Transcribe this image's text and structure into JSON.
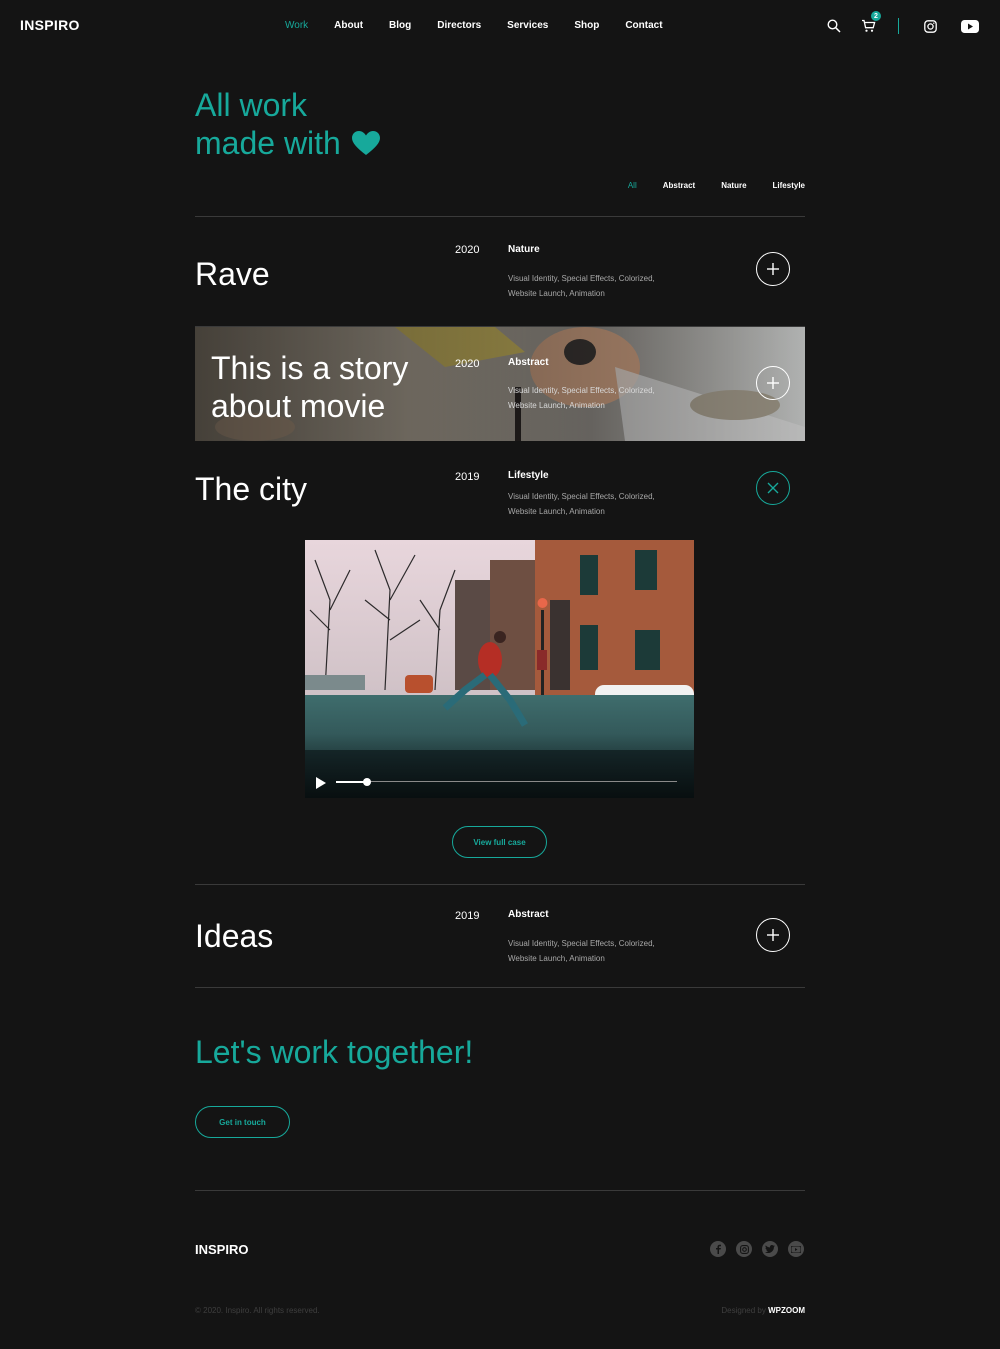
{
  "header": {
    "logo": "INSPIRO",
    "nav": [
      "Work",
      "About",
      "Blog",
      "Directors",
      "Services",
      "Shop",
      "Contact"
    ],
    "active_nav": "Work",
    "cart_count": "2",
    "icons": [
      "search-icon",
      "cart-icon",
      "instagram-icon",
      "youtube-icon"
    ]
  },
  "hero": {
    "line1": "All work",
    "line2": "made with",
    "icon": "heart-icon"
  },
  "filters": [
    "All",
    "Abstract",
    "Nature",
    "Lifestyle"
  ],
  "projects": [
    {
      "title": "Rave",
      "year": "2020",
      "category": "Nature",
      "tags_line1": "Visual Identity, Special Effects, Colorized,",
      "tags_line2": "Website Launch, Animation",
      "action": "plus-icon"
    },
    {
      "title_line1": "This is a story",
      "title_line2": "about movie",
      "year": "2020",
      "category": "Abstract",
      "tags_line1": "Visual Identity, Special Effects, Colorized,",
      "tags_line2": "Website Launch, Animation",
      "action": "plus-icon"
    },
    {
      "title": "The city",
      "year": "2019",
      "category": "Lifestyle",
      "tags_line1": "Visual Identity, Special Effects, Colorized,",
      "tags_line2": "Website Launch, Animation",
      "action": "close-icon"
    },
    {
      "title": "Ideas",
      "year": "2019",
      "category": "Abstract",
      "tags_line1": "Visual Identity, Special Effects, Colorized,",
      "tags_line2": "Website Launch, Animation",
      "action": "plus-icon"
    }
  ],
  "video": {
    "progress": 0.09
  },
  "view_case": "View full case",
  "cta": {
    "title": "Let's work together!",
    "button": "Get in touch"
  },
  "footer": {
    "logo": "INSPIRO",
    "social": [
      "facebook-icon",
      "instagram-icon",
      "twitter-icon",
      "youtube-icon"
    ],
    "copyright": "© 2020. Inspiro. All rights reserved.",
    "designed_by": "Designed by",
    "designer": "WPZOOM"
  },
  "colors": {
    "accent": "#17a99b",
    "background": "#141414",
    "divider": "#3a3a3a"
  }
}
